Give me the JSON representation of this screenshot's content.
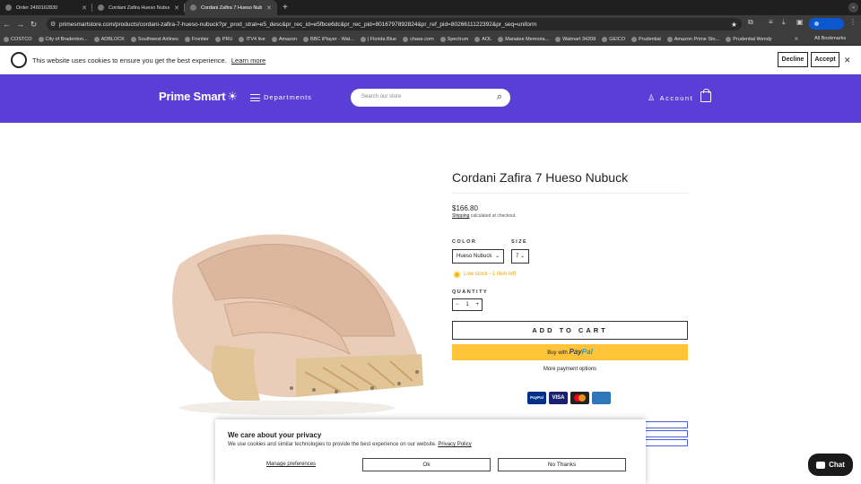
{
  "browser": {
    "tabs": [
      {
        "label": "Order 2460162830",
        "active": false
      },
      {
        "label": "Cordani Zafira Hueso Nubuck",
        "active": false
      },
      {
        "label": "Cordani Zafira 7 Hueso Nubuck",
        "active": true
      }
    ],
    "new_tab": "+",
    "url": "primesmartstore.com/products/cordani-zafira-7-hueso-nubuck?pr_prod_strat=e5_desc&pr_rec_id=e5fbce6dc&pr_rec_pid=8016797892824&pr_ref_pid=8026611122392&pr_seq=uniform",
    "bookmarks": [
      "COSTCO",
      "City of Bradenton...",
      "ADBLOCK",
      "Southwest Airlines",
      "Frontier",
      "PRU",
      "ITV4 live",
      "Amazon",
      "BBC iPlayer - Wat...",
      "| Florida Blue",
      "chase.com",
      "Spectrum",
      "AOL",
      "Manatee Memoria...",
      "Walmart 34208",
      "GEICO",
      "Prudential",
      "Amazon Prime Sto...",
      "Prudential Wendy"
    ],
    "all_bookmarks": "All Bookmarks"
  },
  "cookie_bar": {
    "text": "This website uses cookies to ensure you get the best experience.",
    "learn_more": "Learn more",
    "decline": "Decline",
    "accept": "Accept"
  },
  "header": {
    "logo": "Prime Smart",
    "departments": "Departments",
    "search_placeholder": "Search our store",
    "account": "Account"
  },
  "product": {
    "title": "Cordani Zafira 7 Hueso Nubuck",
    "price": "$166.80",
    "shipping_link": "Shipping",
    "shipping_note": "calculated at checkout.",
    "color_label": "COLOR",
    "color_value": "Hueso Nubuck",
    "size_label": "SIZE",
    "size_value": "7",
    "stock": "Low stock - 1 item left",
    "quantity_label": "QUANTITY",
    "quantity": "1",
    "add_to_cart": "ADD TO CART",
    "paypal_prefix": "Buy with",
    "paypal_pay": "Pay",
    "paypal_pal": "Pal",
    "more_payment": "More payment options",
    "cards": [
      "PayPal",
      "VISA",
      "",
      "AMERICAN EXPRESS"
    ]
  },
  "privacy_modal": {
    "title": "We care about your privacy",
    "body": "We use cookies and similar technologies to provide the best experience on our website.",
    "policy_link": "Privacy Policy",
    "manage": "Manage preferences",
    "ok": "Ok",
    "no_thanks": "No Thanks"
  },
  "chat": {
    "label": "Chat"
  }
}
